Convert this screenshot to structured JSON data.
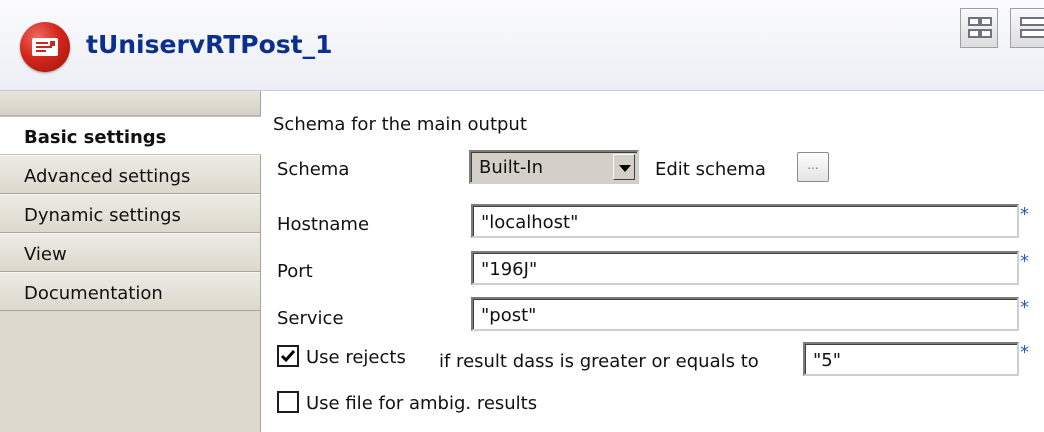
{
  "component": {
    "title": "tUniservRTPost_1",
    "icon": "mail-post-icon"
  },
  "header_buttons": [
    {
      "icon": "grid-layout-icon"
    },
    {
      "icon": "row-layout-icon"
    }
  ],
  "sidebar": {
    "tabs": [
      {
        "label": "Basic settings",
        "active": true
      },
      {
        "label": "Advanced settings",
        "active": false
      },
      {
        "label": "Dynamic settings",
        "active": false
      },
      {
        "label": "View",
        "active": false
      },
      {
        "label": "Documentation",
        "active": false
      }
    ]
  },
  "form": {
    "section_title": "Schema for the main output",
    "schema": {
      "label": "Schema",
      "value": "Built-In",
      "edit_label": "Edit schema",
      "edit_button": "..."
    },
    "hostname": {
      "label": "Hostname",
      "value": "\"localhost\"",
      "required": "*"
    },
    "port": {
      "label": "Port",
      "value": "\"196J\"",
      "required": "*"
    },
    "service": {
      "label": "Service",
      "value": "\"post\"",
      "required": "*"
    },
    "use_rejects": {
      "label": "Use rejects",
      "checked": true,
      "threshold_label": "if result dass is greater or equals to",
      "threshold_value": "\"5\"",
      "required": "*"
    },
    "use_file": {
      "label": "Use file for ambig. results",
      "checked": false
    }
  },
  "colors": {
    "title_blue": "#0b2f8f",
    "icon_red": "#d3261c",
    "required_blue": "#2a5abf"
  }
}
